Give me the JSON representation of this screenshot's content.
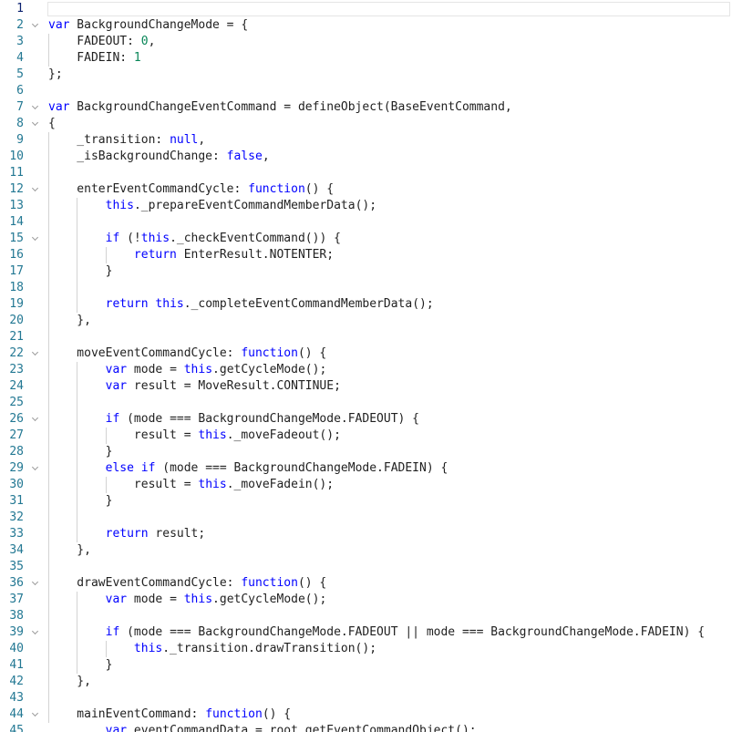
{
  "editor": {
    "colors": {
      "keyword": "#0000ff",
      "number": "#098658",
      "text": "#1f1f1f",
      "line_number": "#237893"
    },
    "lines": [
      {
        "n": "1",
        "t": []
      },
      {
        "n": "2",
        "t": [
          [
            "k",
            "var"
          ],
          [
            "x",
            " BackgroundChangeMode = {"
          ]
        ]
      },
      {
        "n": "3",
        "t": [
          [
            "x",
            "    FADEOUT: "
          ],
          [
            "n",
            "0"
          ],
          [
            "x",
            ","
          ]
        ]
      },
      {
        "n": "4",
        "t": [
          [
            "x",
            "    FADEIN: "
          ],
          [
            "n",
            "1"
          ]
        ]
      },
      {
        "n": "5",
        "t": [
          [
            "x",
            "};"
          ]
        ]
      },
      {
        "n": "6",
        "t": []
      },
      {
        "n": "7",
        "t": [
          [
            "k",
            "var"
          ],
          [
            "x",
            " BackgroundChangeEventCommand = defineObject(BaseEventCommand,"
          ]
        ]
      },
      {
        "n": "8",
        "t": [
          [
            "x",
            "{"
          ]
        ]
      },
      {
        "n": "9",
        "t": [
          [
            "x",
            "    _transition: "
          ],
          [
            "k",
            "null"
          ],
          [
            "x",
            ","
          ]
        ]
      },
      {
        "n": "10",
        "t": [
          [
            "x",
            "    _isBackgroundChange: "
          ],
          [
            "k",
            "false"
          ],
          [
            "x",
            ","
          ]
        ]
      },
      {
        "n": "11",
        "t": []
      },
      {
        "n": "12",
        "t": [
          [
            "x",
            "    enterEventCommandCycle: "
          ],
          [
            "k",
            "function"
          ],
          [
            "x",
            "() {"
          ]
        ]
      },
      {
        "n": "13",
        "t": [
          [
            "x",
            "        "
          ],
          [
            "k",
            "this"
          ],
          [
            "x",
            "._prepareEventCommandMemberData();"
          ]
        ]
      },
      {
        "n": "14",
        "t": []
      },
      {
        "n": "15",
        "t": [
          [
            "x",
            "        "
          ],
          [
            "k",
            "if"
          ],
          [
            "x",
            " (!"
          ],
          [
            "k",
            "this"
          ],
          [
            "x",
            "._checkEventCommand()) {"
          ]
        ]
      },
      {
        "n": "16",
        "t": [
          [
            "x",
            "            "
          ],
          [
            "k",
            "return"
          ],
          [
            "x",
            " EnterResult.NOTENTER;"
          ]
        ]
      },
      {
        "n": "17",
        "t": [
          [
            "x",
            "        }"
          ]
        ]
      },
      {
        "n": "18",
        "t": []
      },
      {
        "n": "19",
        "t": [
          [
            "x",
            "        "
          ],
          [
            "k",
            "return"
          ],
          [
            "x",
            " "
          ],
          [
            "k",
            "this"
          ],
          [
            "x",
            "._completeEventCommandMemberData();"
          ]
        ]
      },
      {
        "n": "20",
        "t": [
          [
            "x",
            "    },"
          ]
        ]
      },
      {
        "n": "21",
        "t": []
      },
      {
        "n": "22",
        "t": [
          [
            "x",
            "    moveEventCommandCycle: "
          ],
          [
            "k",
            "function"
          ],
          [
            "x",
            "() {"
          ]
        ]
      },
      {
        "n": "23",
        "t": [
          [
            "x",
            "        "
          ],
          [
            "k",
            "var"
          ],
          [
            "x",
            " mode = "
          ],
          [
            "k",
            "this"
          ],
          [
            "x",
            ".getCycleMode();"
          ]
        ]
      },
      {
        "n": "24",
        "t": [
          [
            "x",
            "        "
          ],
          [
            "k",
            "var"
          ],
          [
            "x",
            " result = MoveResult.CONTINUE;"
          ]
        ]
      },
      {
        "n": "25",
        "t": []
      },
      {
        "n": "26",
        "t": [
          [
            "x",
            "        "
          ],
          [
            "k",
            "if"
          ],
          [
            "x",
            " (mode === BackgroundChangeMode.FADEOUT) {"
          ]
        ]
      },
      {
        "n": "27",
        "t": [
          [
            "x",
            "            result = "
          ],
          [
            "k",
            "this"
          ],
          [
            "x",
            "._moveFadeout();"
          ]
        ]
      },
      {
        "n": "28",
        "t": [
          [
            "x",
            "        }"
          ]
        ]
      },
      {
        "n": "29",
        "t": [
          [
            "x",
            "        "
          ],
          [
            "k",
            "else"
          ],
          [
            "x",
            " "
          ],
          [
            "k",
            "if"
          ],
          [
            "x",
            " (mode === BackgroundChangeMode.FADEIN) {"
          ]
        ]
      },
      {
        "n": "30",
        "t": [
          [
            "x",
            "            result = "
          ],
          [
            "k",
            "this"
          ],
          [
            "x",
            "._moveFadein();"
          ]
        ]
      },
      {
        "n": "31",
        "t": [
          [
            "x",
            "        }"
          ]
        ]
      },
      {
        "n": "32",
        "t": []
      },
      {
        "n": "33",
        "t": [
          [
            "x",
            "        "
          ],
          [
            "k",
            "return"
          ],
          [
            "x",
            " result;"
          ]
        ]
      },
      {
        "n": "34",
        "t": [
          [
            "x",
            "    },"
          ]
        ]
      },
      {
        "n": "35",
        "t": []
      },
      {
        "n": "36",
        "t": [
          [
            "x",
            "    drawEventCommandCycle: "
          ],
          [
            "k",
            "function"
          ],
          [
            "x",
            "() {"
          ]
        ]
      },
      {
        "n": "37",
        "t": [
          [
            "x",
            "        "
          ],
          [
            "k",
            "var"
          ],
          [
            "x",
            " mode = "
          ],
          [
            "k",
            "this"
          ],
          [
            "x",
            ".getCycleMode();"
          ]
        ]
      },
      {
        "n": "38",
        "t": []
      },
      {
        "n": "39",
        "t": [
          [
            "x",
            "        "
          ],
          [
            "k",
            "if"
          ],
          [
            "x",
            " (mode === BackgroundChangeMode.FADEOUT || mode === BackgroundChangeMode.FADEIN) {"
          ]
        ]
      },
      {
        "n": "40",
        "t": [
          [
            "x",
            "            "
          ],
          [
            "k",
            "this"
          ],
          [
            "x",
            "._transition.drawTransition();"
          ]
        ]
      },
      {
        "n": "41",
        "t": [
          [
            "x",
            "        }"
          ]
        ]
      },
      {
        "n": "42",
        "t": [
          [
            "x",
            "    },"
          ]
        ]
      },
      {
        "n": "43",
        "t": []
      },
      {
        "n": "44",
        "t": [
          [
            "x",
            "    mainEventCommand: "
          ],
          [
            "k",
            "function"
          ],
          [
            "x",
            "() {"
          ]
        ]
      },
      {
        "n": "45",
        "t": [
          [
            "x",
            "        "
          ],
          [
            "k",
            "var"
          ],
          [
            "x",
            " eventCommandData = root.getEventCommandObject();"
          ]
        ]
      }
    ]
  }
}
